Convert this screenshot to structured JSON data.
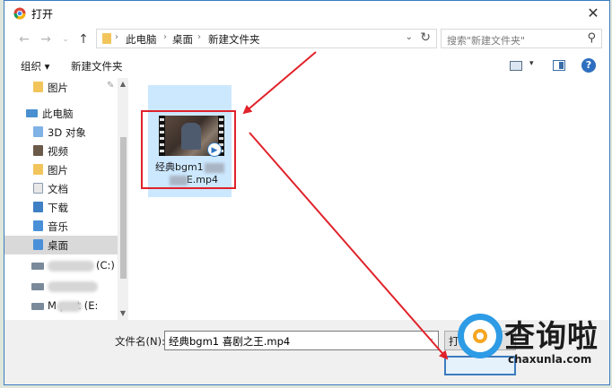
{
  "window": {
    "title": "打开"
  },
  "address": {
    "crumbs": [
      "此电脑",
      "桌面",
      "新建文件夹"
    ],
    "search_placeholder": "搜索\"新建文件夹\""
  },
  "toolbar": {
    "organize": "组织 ▾",
    "new_folder": "新建文件夹"
  },
  "sidebar": {
    "items": [
      {
        "label": "图片",
        "icon": "folder-icon"
      },
      {
        "label": "此电脑",
        "icon": "computer-icon"
      },
      {
        "label": "3D 对象",
        "icon": "3d-objects-icon"
      },
      {
        "label": "视频",
        "icon": "video-folder-icon"
      },
      {
        "label": "图片",
        "icon": "pictures-folder-icon"
      },
      {
        "label": "文档",
        "icon": "documents-folder-icon"
      },
      {
        "label": "下载",
        "icon": "downloads-folder-icon"
      },
      {
        "label": "音乐",
        "icon": "music-folder-icon"
      },
      {
        "label": "桌面",
        "icon": "desktop-folder-icon"
      },
      {
        "label": "(C:)",
        "icon": "drive-icon"
      },
      {
        "label": "",
        "icon": "drive-icon"
      },
      {
        "label": "M    port (E:",
        "icon": "drive-icon"
      }
    ]
  },
  "file": {
    "name_line1": "经典bgm1",
    "name_line2": "E.mp4"
  },
  "footer": {
    "filename_label": "文件名(N):",
    "filename_value": "经典bgm1 喜剧之王.mp4",
    "open_label": "打"
  },
  "watermark": {
    "text": "查询啦",
    "domain": "chaxunla.com"
  },
  "colors": {
    "accent": "#3b7bbf",
    "highlight": "#e0222a",
    "selected_tile": "#cce8ff"
  }
}
